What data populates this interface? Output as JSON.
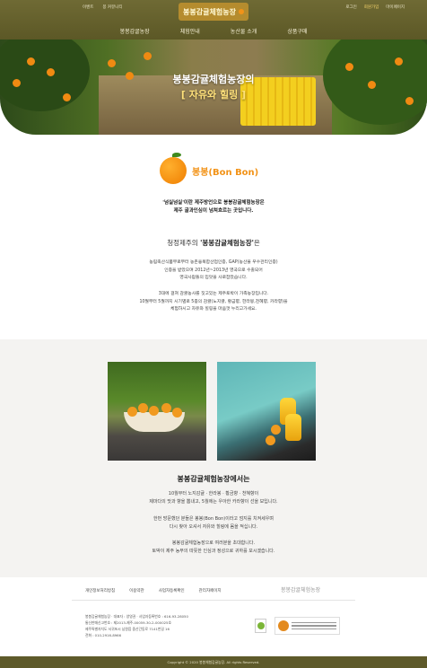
{
  "header": {
    "util_left": [
      "이벤트",
      "봉 커뮤니티"
    ],
    "util_right": [
      "로그인",
      "회원가입",
      "마이페이지"
    ],
    "logo_text": "봉봉감귤체험농장",
    "nav": [
      "봉봉감귤농장",
      "체험안내",
      "농산물 소개",
      "상품구매"
    ]
  },
  "hero": {
    "title": "봉봉감귤체험농장의",
    "subtitle": "[ 자유와 힐링 ]"
  },
  "intro": {
    "bonbon": "봉봉(Bon Bon)",
    "lead_line1": "'넘실넘실'이란 제주방언으로 봉봉감귤체험농장은",
    "lead_line2": "제주 귤과인심이 넘쳐흐르는 곳입니다.",
    "heading_prefix": "청정제주의 ",
    "heading_bold": "'봉봉감귤체험농장'",
    "heading_suffix": "은",
    "para1_line1": "농림축산식품부로부터 농촌융복합산업인증, GAP(농산물 우수관리인증)",
    "para1_line2": "인증을 받았으며 2012년~2013년 영국으로 수출되어",
    "para1_line3": "영국사람들의 입맛을 사로잡았습니다.",
    "para2_line1": "3대에 걸쳐 감귤농사를 짓고있는 제주토박이 가족농장입니다.",
    "para2_line2": "10월부터 5월까지 시기별로 5종의 감귤(노지귤, 황금향, 한라봉,천혜향, 카라향)을",
    "para2_line3": "체험하시고 자유와 힐링을 마음껏 누리고가세요."
  },
  "middle": {
    "title": "봉봉감귤체험농장에서는",
    "p1_line1": "10월부터 노지감귤 · 한라봉 · 황금향 · 천혜향이",
    "p1_line2": "제마다의 맛과 향을 뽐내고, 5월에는 우아한 카라향이 선을 보입니다.",
    "p2_line1": "한번 방문했던 분들은 봉봉(Bon Bon)이라고 엄지를 치켜세우며",
    "p2_line2": "다시 찾아 오셔서 자유와 힐링에 몸을 적십니다.",
    "p3_line1": "봉봉감귤체험농장으로 여러분을 초대합니다.",
    "p3_line2": "토박이 제주 농부의 따뜻한 인심과 정성으로 귀하를 모시겠습니다."
  },
  "footer": {
    "links": [
      "개인정보처리방침",
      "이용약관",
      "사업자등록확인",
      "관리자페이지"
    ],
    "logo_text": "봉봉감귤체험농장",
    "info_line1": "봉봉감귤체험농장 · 대표자 : 양영권 · 사업자등록번호 : 616-93-28050",
    "info_line2": "통신판매신고번호 : 제2013-제주-00059-30-2-000025호",
    "info_line3": "제주특별자치도 서귀포시 남원읍 중산간동로 7141번길 16",
    "info_line4": "전화 : 010-2916-8966",
    "copyright": "Copyright © 2020 봉봉체험감귤농장. All rights Reserved."
  },
  "colors": {
    "header_bg": "#5c5826",
    "accent_orange": "#f29318",
    "section_gray": "#f4f3f1"
  }
}
